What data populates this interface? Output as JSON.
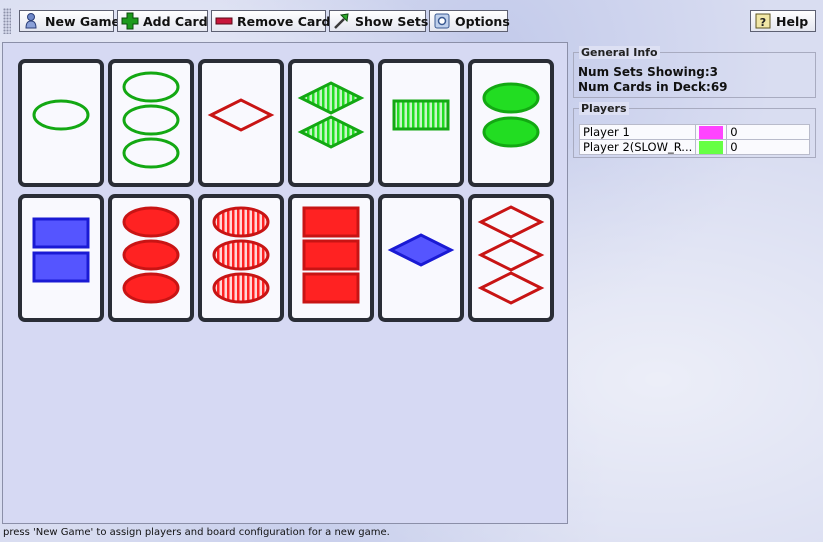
{
  "toolbar": {
    "new_game": "New Game",
    "add_card": "Add Card",
    "remove_card": "Remove Card",
    "show_sets": "Show Sets",
    "options": "Options",
    "help": "Help"
  },
  "general_info": {
    "title": "General Info",
    "sets_showing": "Num Sets Showing:3",
    "cards_in_deck": "Num Cards in Deck:69"
  },
  "players": {
    "title": "Players",
    "list": [
      {
        "name": "Player 1",
        "color": "#ff44ff",
        "score": "0"
      },
      {
        "name": "Player 2(SLOW_R...",
        "color": "#66ff44",
        "score": "0"
      }
    ]
  },
  "colors": {
    "green": "#13a813",
    "red": "#c81414",
    "blue": "#1a1ad4"
  },
  "cards": [
    {
      "number": 1,
      "color": "green",
      "shape": "oval",
      "fill": "empty"
    },
    {
      "number": 3,
      "color": "green",
      "shape": "oval",
      "fill": "empty"
    },
    {
      "number": 1,
      "color": "red",
      "shape": "diamond",
      "fill": "empty"
    },
    {
      "number": 2,
      "color": "green",
      "shape": "diamond",
      "fill": "striped"
    },
    {
      "number": 1,
      "color": "green",
      "shape": "rectangle",
      "fill": "striped"
    },
    {
      "number": 2,
      "color": "green",
      "shape": "oval",
      "fill": "solid"
    },
    {
      "number": 2,
      "color": "blue",
      "shape": "rectangle",
      "fill": "solid"
    },
    {
      "number": 3,
      "color": "red",
      "shape": "oval",
      "fill": "solid"
    },
    {
      "number": 3,
      "color": "red",
      "shape": "oval",
      "fill": "striped"
    },
    {
      "number": 3,
      "color": "red",
      "shape": "rectangle",
      "fill": "solid"
    },
    {
      "number": 1,
      "color": "blue",
      "shape": "diamond",
      "fill": "solid"
    },
    {
      "number": 3,
      "color": "red",
      "shape": "diamond",
      "fill": "empty"
    }
  ],
  "status_text": "press 'New Game' to assign players and board configuration for a new game."
}
